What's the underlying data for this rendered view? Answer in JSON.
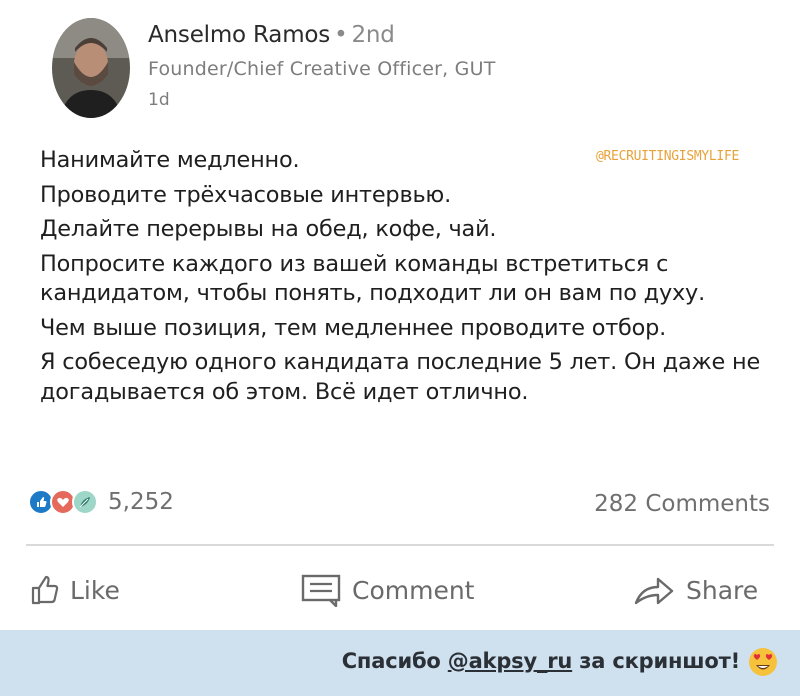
{
  "author": {
    "name": "Anselmo Ramos",
    "separator": "•",
    "degree": "2nd",
    "title": "Founder/Chief Creative Officer, GUT",
    "time": "1d"
  },
  "watermark": "@RECRUITINGISMYLIFE",
  "post": {
    "paragraphs": [
      "Нанимайте медленно.",
      "Проводите трёхчасовые интервью.",
      "Делайте перерывы на обед, кофе, чай.",
      "Попросите каждого из вашей команды встретиться с кандидатом, чтобы понять, подходит ли он вам по духу.",
      "Чем выше позиция, тем медленнее проводите отбор.",
      "Я собеседую одного кандидата последние 5 лет. Он даже не догадывается об этом. Всё идет отлично."
    ]
  },
  "social": {
    "reactions_count": "5,252",
    "comments_count": "282 Comments",
    "reaction_icons": [
      "like-icon",
      "love-icon",
      "insightful-icon"
    ]
  },
  "actions": {
    "like": "Like",
    "comment": "Comment",
    "share": "Share"
  },
  "banner": {
    "prefix": "Спасибо ",
    "handle": "@akpsy_ru",
    "suffix": " за скриншот!",
    "emoji": "heart-eyes-emoji"
  },
  "colors": {
    "banner_bg": "#cfe0ee",
    "watermark": "#e8a23a",
    "like": "#1c7ac7",
    "love": "#e56a5b"
  }
}
